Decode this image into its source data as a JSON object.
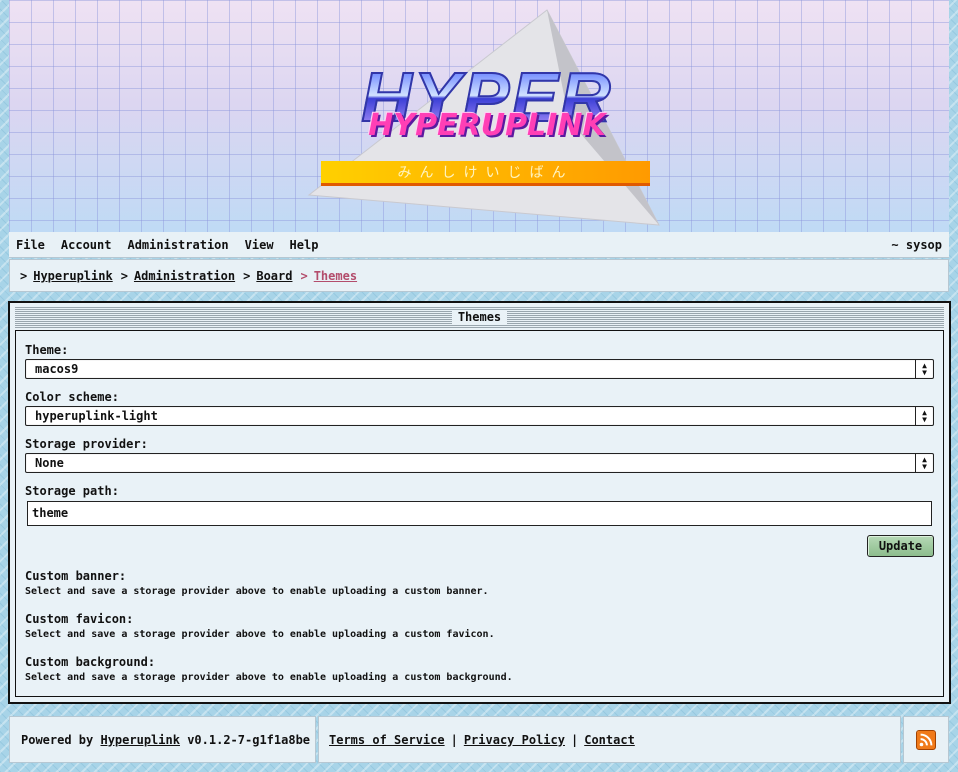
{
  "banner": {
    "logo_title": "HYPER",
    "logo_subtitle": "HYPERUPLINK",
    "logo_kana": "みんしけいじばん"
  },
  "menu": {
    "items": [
      "File",
      "Account",
      "Administration",
      "View",
      "Help"
    ],
    "user": "~ sysop"
  },
  "breadcrumb": {
    "items": [
      "Hyperuplink",
      "Administration",
      "Board"
    ],
    "current": "Themes",
    "separator": ">"
  },
  "panel": {
    "title": "Themes",
    "theme_label": "Theme:",
    "theme_value": "macos9",
    "color_label": "Color scheme:",
    "color_value": "hyperuplink-light",
    "storage_label": "Storage provider:",
    "storage_value": "None",
    "path_label": "Storage path:",
    "path_value": "theme",
    "update_label": "Update",
    "banner_label": "Custom banner:",
    "banner_help": "Select and save a storage provider above to enable uploading a custom banner.",
    "favicon_label": "Custom favicon:",
    "favicon_help": "Select and save a storage provider above to enable uploading a custom favicon.",
    "background_label": "Custom background:",
    "background_help": "Select and save a storage provider above to enable uploading a custom background."
  },
  "footer": {
    "powered_prefix": "Powered by",
    "powered_link": "Hyperuplink",
    "version": "v0.1.2-7-g1f1a8be",
    "tos": "Terms of Service",
    "privacy": "Privacy Policy",
    "contact": "Contact",
    "pipe": "|",
    "rss_icon": "rss-icon"
  },
  "colors": {
    "breadcrumb_current": "#b34d6c",
    "update_button": "#9fcb9f",
    "rss": "#f07a1a"
  }
}
